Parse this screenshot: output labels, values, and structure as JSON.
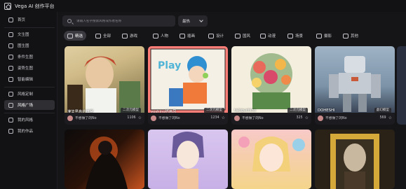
{
  "app": {
    "title": "Vega AI 创作平台"
  },
  "sidebar": {
    "items": [
      {
        "label": "首页",
        "active": false
      },
      {
        "label": "文生图",
        "active": false
      },
      {
        "label": "图生图",
        "active": false
      },
      {
        "label": "条件生图",
        "active": false
      },
      {
        "label": "姿势生图",
        "active": false
      },
      {
        "label": "智能编辑",
        "active": false
      },
      {
        "label": "风格定制",
        "active": false
      },
      {
        "label": "风格广场",
        "active": true
      },
      {
        "label": "我的风格",
        "active": false
      },
      {
        "label": "我的作品",
        "active": false
      }
    ]
  },
  "search": {
    "placeholder": "请输入名字搜索风格或作者名称"
  },
  "sort": {
    "value": "最热"
  },
  "categories": [
    {
      "label": "精选",
      "icon": "heart-icon",
      "active": true
    },
    {
      "label": "全部",
      "icon": "grid-icon",
      "active": false
    },
    {
      "label": "游戏",
      "icon": "gamepad-icon",
      "active": false
    },
    {
      "label": "人物",
      "icon": "person-icon",
      "active": false
    },
    {
      "label": "插画",
      "icon": "image-icon",
      "active": false
    },
    {
      "label": "设计",
      "icon": "design-icon",
      "active": false
    },
    {
      "label": "国风",
      "icon": "palette-icon",
      "active": false
    },
    {
      "label": "动漫",
      "icon": "mask-icon",
      "active": false
    },
    {
      "label": "场景",
      "icon": "landscape-icon",
      "active": false
    },
    {
      "label": "摄影",
      "icon": "camera-icon",
      "active": false
    },
    {
      "label": "其他",
      "icon": "other-icon",
      "active": false
    }
  ],
  "cards": [
    {
      "name": "灌篮男高的日常",
      "tag": "二次元模型",
      "author": "不想做了的No",
      "likes": "1106",
      "colors": [
        "#c9b27a",
        "#5a7a4a",
        "#e8d6b0"
      ]
    },
    {
      "name": "yoshino插画风",
      "tag": "二次元模型",
      "author": "不想做了的No",
      "likes": "1234",
      "colors": [
        "#ff7e78",
        "#4fb4d6",
        "#f2efe6"
      ]
    },
    {
      "name": "takiguchino",
      "tag": "二次元模型",
      "author": "不想做了的No",
      "likes": "325",
      "colors": [
        "#f3eedd",
        "#6a9a5a",
        "#e86a5a"
      ]
    },
    {
      "name": "DOHESHI",
      "tag": "虚幻模型",
      "author": "不想做了的No",
      "likes": "569",
      "colors": [
        "#7c93a8",
        "#d8dde3",
        "#c85a3a"
      ]
    }
  ],
  "bottom_cards": [
    {
      "colors": [
        "#0d0b0b",
        "#c8531f"
      ]
    },
    {
      "colors": [
        "#d9c6ef",
        "#f2c6a0"
      ]
    },
    {
      "colors": [
        "#f7c9c8",
        "#f4d58a"
      ]
    },
    {
      "colors": [
        "#2a2216",
        "#d4a93a"
      ]
    }
  ]
}
